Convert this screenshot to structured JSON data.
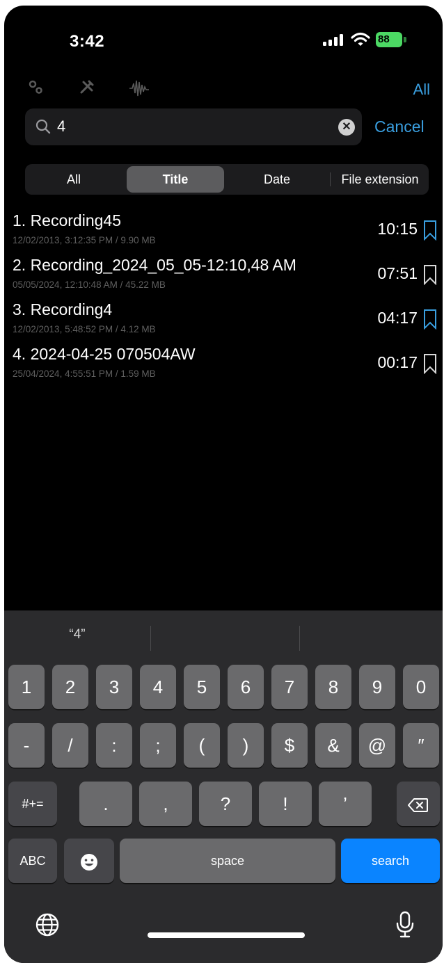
{
  "status": {
    "time": "3:42",
    "battery": "88"
  },
  "toolbar": {
    "all_label": "All"
  },
  "search": {
    "value": "4",
    "cancel_label": "Cancel"
  },
  "segments": [
    "All",
    "Title",
    "Date",
    "File extension"
  ],
  "recordings": [
    {
      "title": "1. Recording45",
      "meta": "12/02/2013, 3:12:35 PM / 9.90 MB",
      "duration": "10:15",
      "bookmarked": true
    },
    {
      "title": "2. Recording_2024_05_05-12:10,48 AM",
      "meta": "05/05/2024, 12:10:48 AM / 45.22 MB",
      "duration": "07:51",
      "bookmarked": false
    },
    {
      "title": "3. Recording4",
      "meta": "12/02/2013, 5:48:52 PM / 4.12 MB",
      "duration": "04:17",
      "bookmarked": true
    },
    {
      "title": "4. 2024-04-25 070504AW",
      "meta": "25/04/2024, 4:55:51 PM / 1.59 MB",
      "duration": "00:17",
      "bookmarked": false
    }
  ],
  "keyboard": {
    "suggestion": "“4”",
    "row1": [
      "1",
      "2",
      "3",
      "4",
      "5",
      "6",
      "7",
      "8",
      "9",
      "0"
    ],
    "row2": [
      "-",
      "/",
      ":",
      ";",
      "(",
      ")",
      "$",
      "&",
      "@",
      "″"
    ],
    "row3": [
      ".",
      ",",
      "?",
      "!",
      "’"
    ],
    "symbols_label": "#+=",
    "abc_label": "ABC",
    "space_label": "space",
    "search_label": "search"
  },
  "colors": {
    "accent": "#3a9fe0",
    "search_key": "#0a84ff",
    "battery": "#4cd964"
  }
}
